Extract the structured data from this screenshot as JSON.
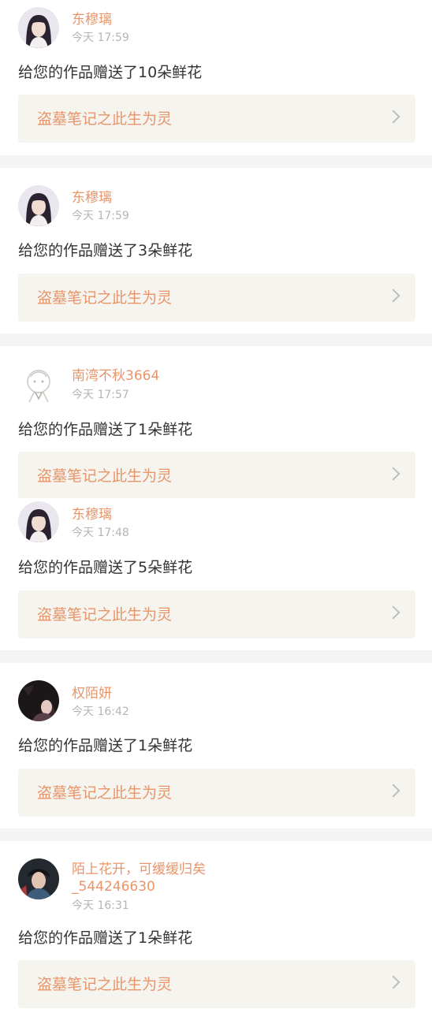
{
  "notifications": [
    {
      "user": "东穆璃",
      "time": "今天 17:59",
      "message": "给您的作品赠送了10朵鲜花",
      "work": "盗墓笔记之此生为灵",
      "avatar_icon": "girl-portrait-avatar"
    },
    {
      "user": "东穆璃",
      "time": "今天 17:59",
      "message": "给您的作品赠送了3朵鲜花",
      "work": "盗墓笔记之此生为灵",
      "avatar_icon": "girl-portrait-avatar"
    },
    {
      "user": "南湾不秋3664",
      "time": "今天 17:57",
      "message": "给您的作品赠送了1朵鲜花",
      "work": "盗墓笔记之此生为灵",
      "avatar_icon": "cartoon-sketch-avatar"
    },
    {
      "user": "东穆璃",
      "time": "今天 17:48",
      "message": "给您的作品赠送了5朵鲜花",
      "work": "盗墓笔记之此生为灵",
      "avatar_icon": "girl-portrait-avatar"
    },
    {
      "user": "权陌妍",
      "time": "今天 16:42",
      "message": "给您的作品赠送了1朵鲜花",
      "work": "盗墓笔记之此生为灵",
      "avatar_icon": "dark-girl-avatar"
    },
    {
      "user": "陌上花开，可缓缓归矣_544246630",
      "user_line1": "陌上花开，可缓缓归矣",
      "user_line2": "_544246630",
      "time": "今天 16:31",
      "message": "给您的作品赠送了1朵鲜花",
      "work": "盗墓笔记之此生为灵",
      "avatar_icon": "boy-portrait-avatar"
    }
  ],
  "colors": {
    "accent": "#e8956a",
    "work_bg": "#f5f4ee",
    "divider": "#f4f4f4",
    "text": "#333333",
    "muted": "#b5b5b5"
  }
}
